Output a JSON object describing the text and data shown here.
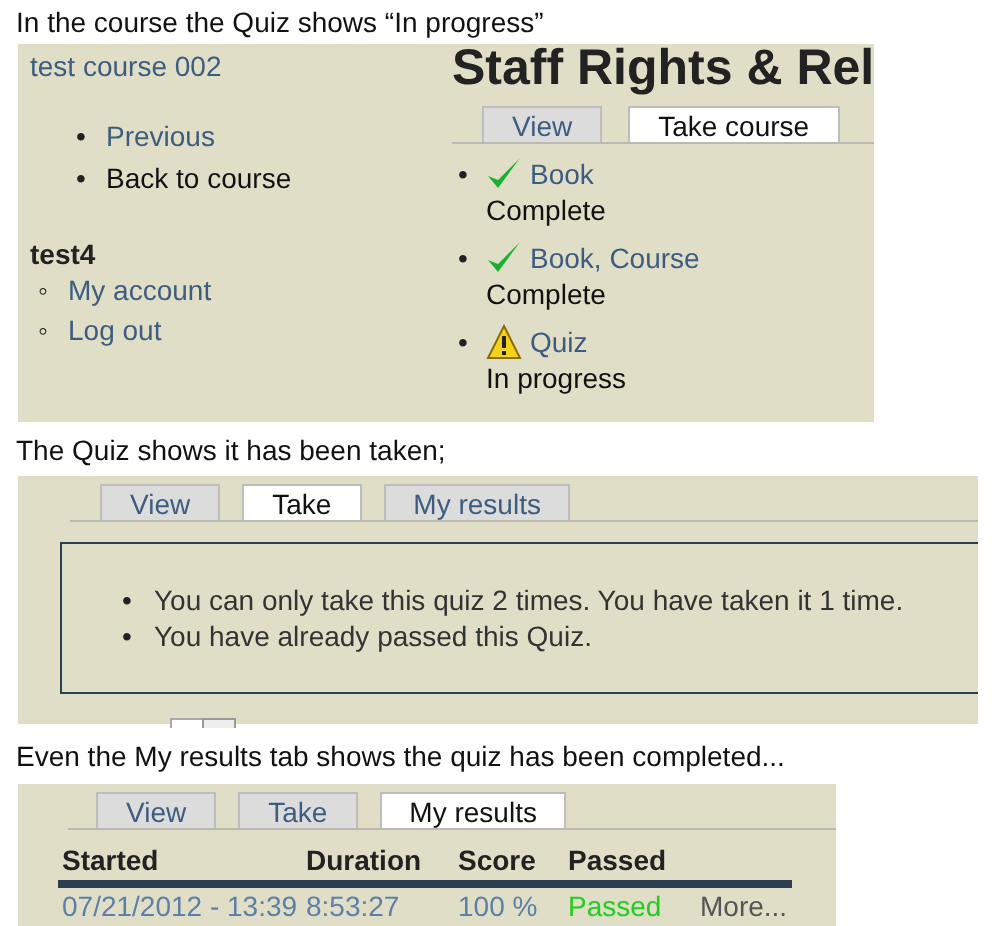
{
  "caption_1": "In the course the Quiz shows “In progress”",
  "course_page": {
    "course_link": "test course 002",
    "menu": [
      {
        "bullet": "•",
        "label": "Previous",
        "kind": "link"
      },
      {
        "bullet": "•",
        "label": "Back to course",
        "kind": "text"
      }
    ],
    "user": {
      "name": "test4",
      "links": [
        {
          "bullet": "◦",
          "label": "My account"
        },
        {
          "bullet": "◦",
          "label": "Log out"
        }
      ]
    },
    "title": "Staff Rights & Rel",
    "tabs": [
      {
        "label": "View",
        "selected": false
      },
      {
        "label": "Take course",
        "selected": true
      }
    ],
    "items": [
      {
        "bullet": "•",
        "title": "Book",
        "status": "Complete",
        "kind": "complete"
      },
      {
        "bullet": "•",
        "title": "Book, Course",
        "status": "Complete",
        "kind": "complete"
      },
      {
        "bullet": "•",
        "title": "Quiz",
        "status": "In progress",
        "kind": "in_progress"
      }
    ]
  },
  "caption_2": "The Quiz shows it has been taken;",
  "quiz_page": {
    "tabs": [
      {
        "label": "View",
        "selected": false
      },
      {
        "label": "Take",
        "selected": true
      },
      {
        "label": "My results",
        "selected": false
      }
    ],
    "messages": [
      {
        "bullet": "•",
        "text": "You can only take this quiz 2 times. You have taken it 1 time."
      },
      {
        "bullet": "•",
        "text": "You have already passed this Quiz."
      }
    ]
  },
  "caption_3": "Even the My results tab shows the quiz has been completed...",
  "results_page": {
    "tabs": [
      {
        "label": "View",
        "selected": false
      },
      {
        "label": "Take",
        "selected": false
      },
      {
        "label": "My results",
        "selected": true
      }
    ],
    "columns": [
      "Started",
      "Duration",
      "Score",
      "Passed"
    ],
    "rows": [
      {
        "started": "07/21/2012 - 13:39",
        "duration": "8:53:27",
        "score": "100 %",
        "passed": "Passed",
        "more": "More..."
      }
    ]
  }
}
